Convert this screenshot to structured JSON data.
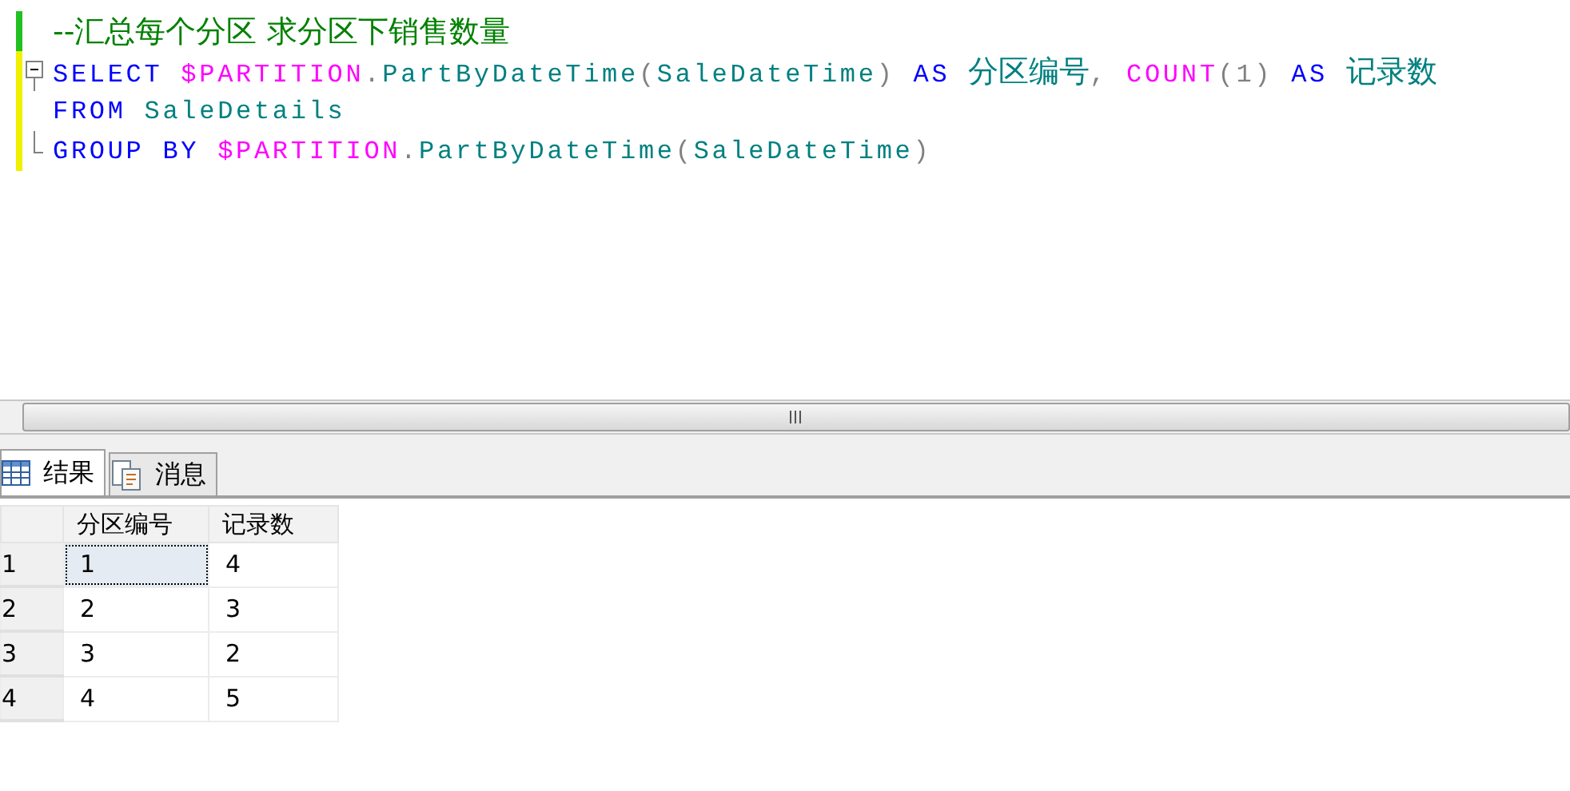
{
  "editor": {
    "lines": [
      {
        "saved": true,
        "fold_start": false,
        "fold_end": false,
        "tokens": [
          {
            "kind": "comment",
            "text": "--汇总每个分区 求分区下销售数量"
          }
        ]
      },
      {
        "saved": false,
        "fold_start": true,
        "fold_end": false,
        "tokens": [
          {
            "kind": "keyword",
            "text": "SELECT "
          },
          {
            "kind": "system",
            "text": "$PARTITION"
          },
          {
            "kind": "plain",
            "text": "."
          },
          {
            "kind": "name",
            "text": "PartByDateTime"
          },
          {
            "kind": "plain",
            "text": "("
          },
          {
            "kind": "name",
            "text": "SaleDateTime"
          },
          {
            "kind": "plain",
            "text": ") "
          },
          {
            "kind": "keyword",
            "text": "AS "
          },
          {
            "kind": "name",
            "text": "分区编号"
          },
          {
            "kind": "plain",
            "text": ", "
          },
          {
            "kind": "system",
            "text": "COUNT"
          },
          {
            "kind": "plain",
            "text": "(1) "
          },
          {
            "kind": "keyword",
            "text": "AS "
          },
          {
            "kind": "name",
            "text": "记录数"
          }
        ]
      },
      {
        "saved": false,
        "fold_start": false,
        "fold_end": false,
        "tokens": [
          {
            "kind": "keyword",
            "text": "FROM "
          },
          {
            "kind": "name",
            "text": "SaleDetails"
          }
        ]
      },
      {
        "saved": false,
        "fold_start": false,
        "fold_end": true,
        "tokens": [
          {
            "kind": "keyword",
            "text": "GROUP BY "
          },
          {
            "kind": "system",
            "text": "$PARTITION"
          },
          {
            "kind": "plain",
            "text": "."
          },
          {
            "kind": "name",
            "text": "PartByDateTime"
          },
          {
            "kind": "plain",
            "text": "("
          },
          {
            "kind": "name",
            "text": "SaleDateTime"
          },
          {
            "kind": "plain",
            "text": ")"
          }
        ]
      }
    ]
  },
  "tabs": [
    {
      "label": "结果",
      "selected": true
    },
    {
      "label": "消息",
      "selected": false
    }
  ],
  "grid": {
    "columns": [
      "分区编号",
      "记录数"
    ],
    "rows": [
      {
        "number": "1",
        "cells": [
          "1",
          "4"
        ],
        "selected": true
      },
      {
        "number": "2",
        "cells": [
          "2",
          "3"
        ],
        "selected": false
      },
      {
        "number": "3",
        "cells": [
          "3",
          "2"
        ],
        "selected": false
      },
      {
        "number": "4",
        "cells": [
          "4",
          "5"
        ],
        "selected": false
      }
    ]
  }
}
